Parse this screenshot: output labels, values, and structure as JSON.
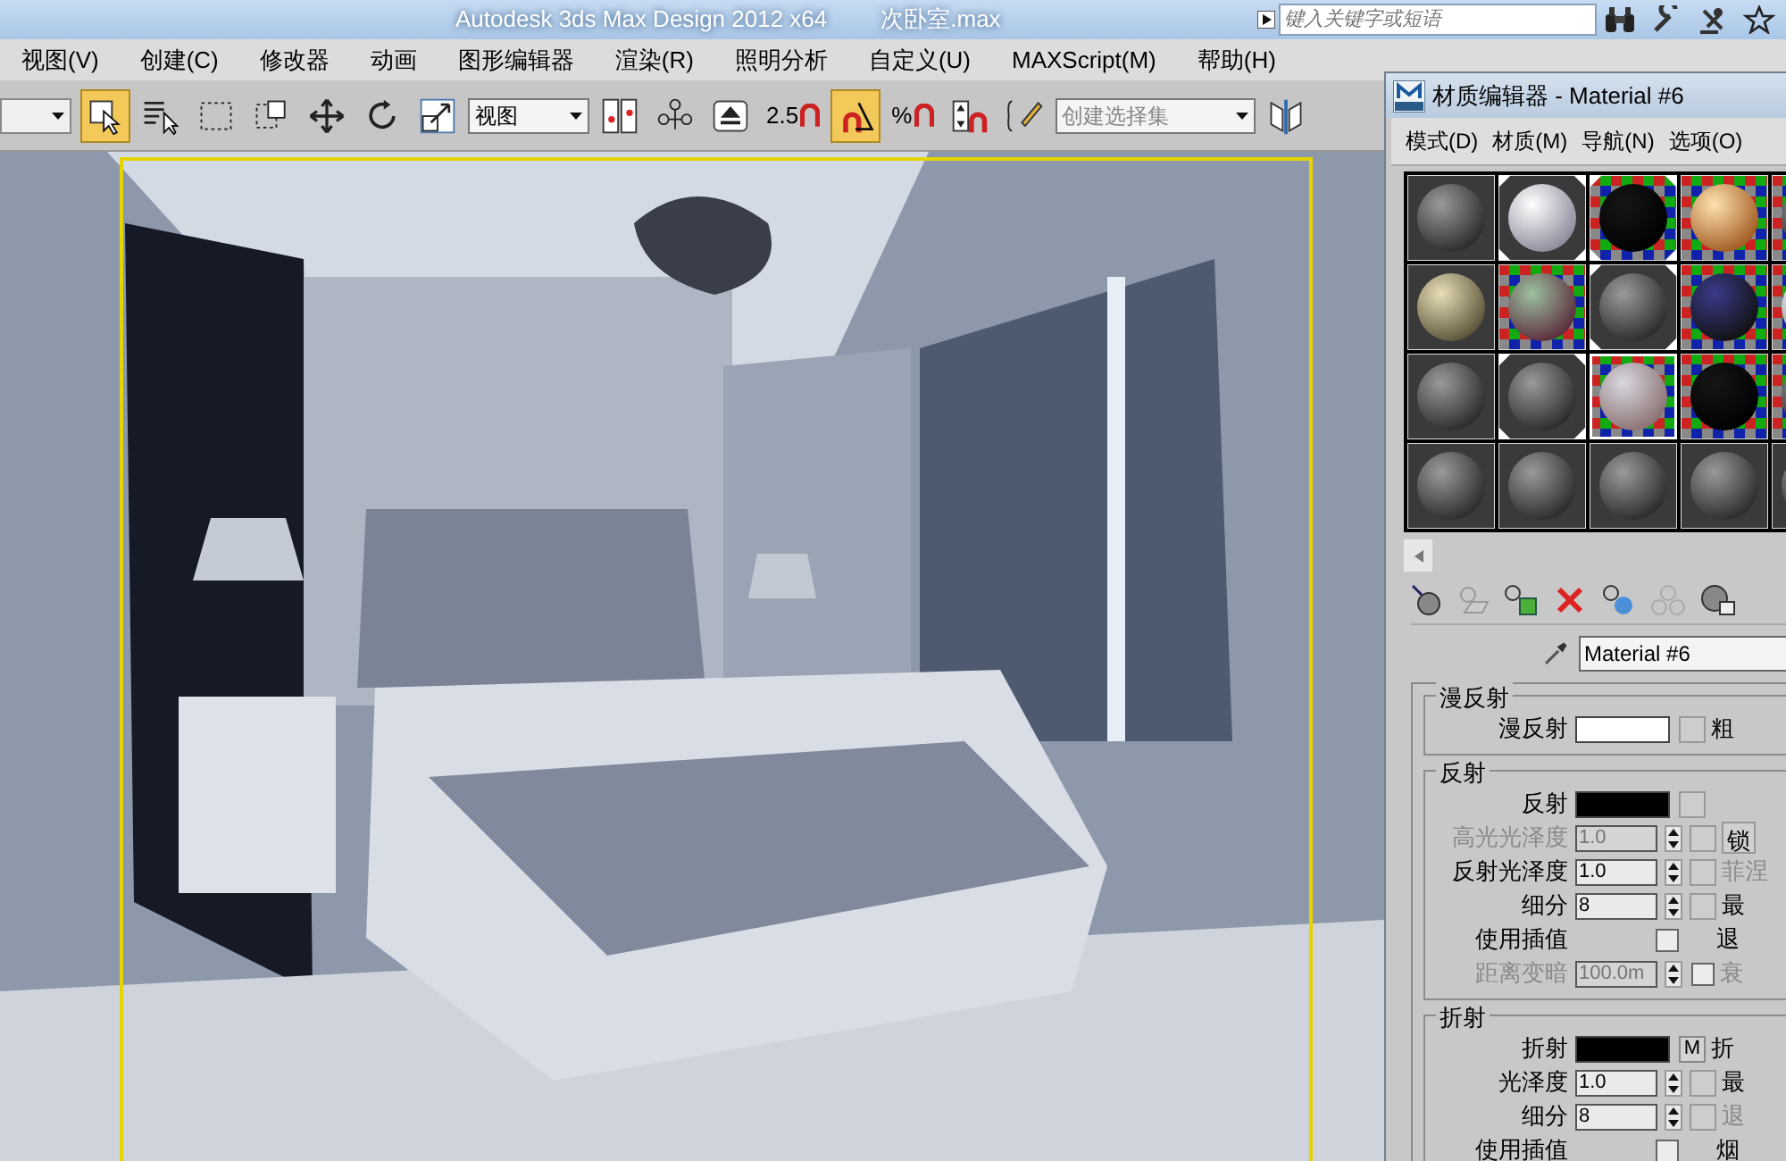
{
  "window": {
    "title": "Autodesk 3ds Max Design 2012 x64",
    "file": "次卧室.max"
  },
  "search": {
    "placeholder": "键入关键字或短语"
  },
  "menu": [
    "视图(V)",
    "创建(C)",
    "修改器",
    "动画",
    "图形编辑器",
    "渲染(R)",
    "照明分析",
    "自定义(U)",
    "MAXScript(M)",
    "帮助(H)"
  ],
  "toolbar": [
    {
      "kind": "stub"
    },
    {
      "kind": "select",
      "selected": true
    },
    {
      "kind": "select-by-name",
      "selected": false
    },
    {
      "kind": "rect-region",
      "selected": false
    },
    {
      "kind": "window-crossing",
      "selected": false
    },
    {
      "kind": "move",
      "selected": false
    },
    {
      "kind": "rotate",
      "selected": false
    },
    {
      "kind": "scale",
      "selected": false
    },
    {
      "kind": "dropdown",
      "value": "视图"
    },
    {
      "kind": "pivot",
      "selected": false
    },
    {
      "kind": "manipulate",
      "selected": false
    },
    {
      "kind": "shortcut",
      "selected": false
    },
    {
      "kind": "snap",
      "label": "2.5",
      "selected": false
    },
    {
      "kind": "angle-snap",
      "selected": true
    },
    {
      "kind": "percent-snap",
      "label": "%",
      "selected": false
    },
    {
      "kind": "spinner-snap",
      "selected": false
    },
    {
      "kind": "named-sets",
      "selected": false
    },
    {
      "kind": "selection-set",
      "placeholder": "创建选择集"
    },
    {
      "kind": "mirror",
      "selected": false
    }
  ],
  "viewport": {
    "active": true
  },
  "material_editor": {
    "title": "材质编辑器 - Material #6",
    "menu": [
      "模式(D)",
      "材质(M)",
      "导航(N)",
      "选项(O)"
    ],
    "slots": [
      {
        "kind": "grey",
        "checker": false,
        "in_scene": false,
        "selected": false
      },
      {
        "kind": "white",
        "checker": false,
        "in_scene": true,
        "selected": false
      },
      {
        "kind": "dark",
        "checker": true,
        "in_scene": true,
        "selected": false
      },
      {
        "kind": "orange",
        "checker": true,
        "in_scene": false,
        "selected": false
      },
      {
        "kind": "grey",
        "checker": true,
        "in_scene": false,
        "selected": false
      },
      {
        "kind": "stone",
        "checker": false,
        "in_scene": false,
        "selected": false
      },
      {
        "kind": "glossy",
        "checker": true,
        "in_scene": false,
        "selected": false
      },
      {
        "kind": "grey",
        "checker": false,
        "in_scene": true,
        "selected": false
      },
      {
        "kind": "pattern",
        "checker": true,
        "in_scene": false,
        "selected": false
      },
      {
        "kind": "white",
        "checker": true,
        "in_scene": false,
        "selected": false
      },
      {
        "kind": "grey",
        "checker": false,
        "in_scene": false,
        "selected": false
      },
      {
        "kind": "grey",
        "checker": false,
        "in_scene": true,
        "selected": false
      },
      {
        "kind": "tinted",
        "checker": true,
        "in_scene": false,
        "selected": true
      },
      {
        "kind": "dark",
        "checker": true,
        "in_scene": false,
        "selected": false
      },
      {
        "kind": "grey",
        "checker": true,
        "in_scene": false,
        "selected": false
      },
      {
        "kind": "grey",
        "checker": false,
        "in_scene": false,
        "selected": false
      },
      {
        "kind": "grey",
        "checker": false,
        "in_scene": false,
        "selected": false
      },
      {
        "kind": "grey",
        "checker": false,
        "in_scene": false,
        "selected": false
      },
      {
        "kind": "grey",
        "checker": false,
        "in_scene": false,
        "selected": false
      },
      {
        "kind": "grey",
        "checker": false,
        "in_scene": false,
        "selected": false
      }
    ],
    "material_name": "Material #6",
    "groups": [
      {
        "title": "漫反射",
        "rows": [
          {
            "kind": "color",
            "label": "漫反射",
            "color": "#ffffff",
            "side": "粗",
            "side_disabled": false
          }
        ]
      },
      {
        "title": "反射",
        "rows": [
          {
            "kind": "color",
            "label": "反射",
            "color": "#000000"
          },
          {
            "kind": "spinner",
            "label": "高光光泽度",
            "value": "1.0",
            "disabled": true,
            "button": "锁"
          },
          {
            "kind": "spinner",
            "label": "反射光泽度",
            "value": "1.0",
            "disabled": false,
            "side": "菲涅",
            "side_disabled": true
          },
          {
            "kind": "spinner",
            "label": "细分",
            "value": "8",
            "disabled": false,
            "side": "最",
            "side_disabled": false
          },
          {
            "kind": "checkbox",
            "label": "使用插值",
            "checked": false,
            "side": "退",
            "side_disabled": false
          },
          {
            "kind": "spinner",
            "label": "距离变暗",
            "value": "100.0m",
            "disabled": true,
            "checked": false,
            "side": "衰",
            "side_disabled": true
          }
        ]
      },
      {
        "title": "折射",
        "rows": [
          {
            "kind": "color",
            "label": "折射",
            "color": "#000000",
            "button": "M",
            "side": "折",
            "side_disabled": false
          },
          {
            "kind": "spinner",
            "label": "光泽度",
            "value": "1.0",
            "disabled": false,
            "side": "最",
            "side_disabled": false
          },
          {
            "kind": "spinner",
            "label": "细分",
            "value": "8",
            "disabled": false,
            "side": "退",
            "side_disabled": true
          },
          {
            "kind": "checkbox",
            "label": "使用插值",
            "checked": false,
            "side": "烟",
            "side_disabled": false
          }
        ]
      }
    ]
  }
}
